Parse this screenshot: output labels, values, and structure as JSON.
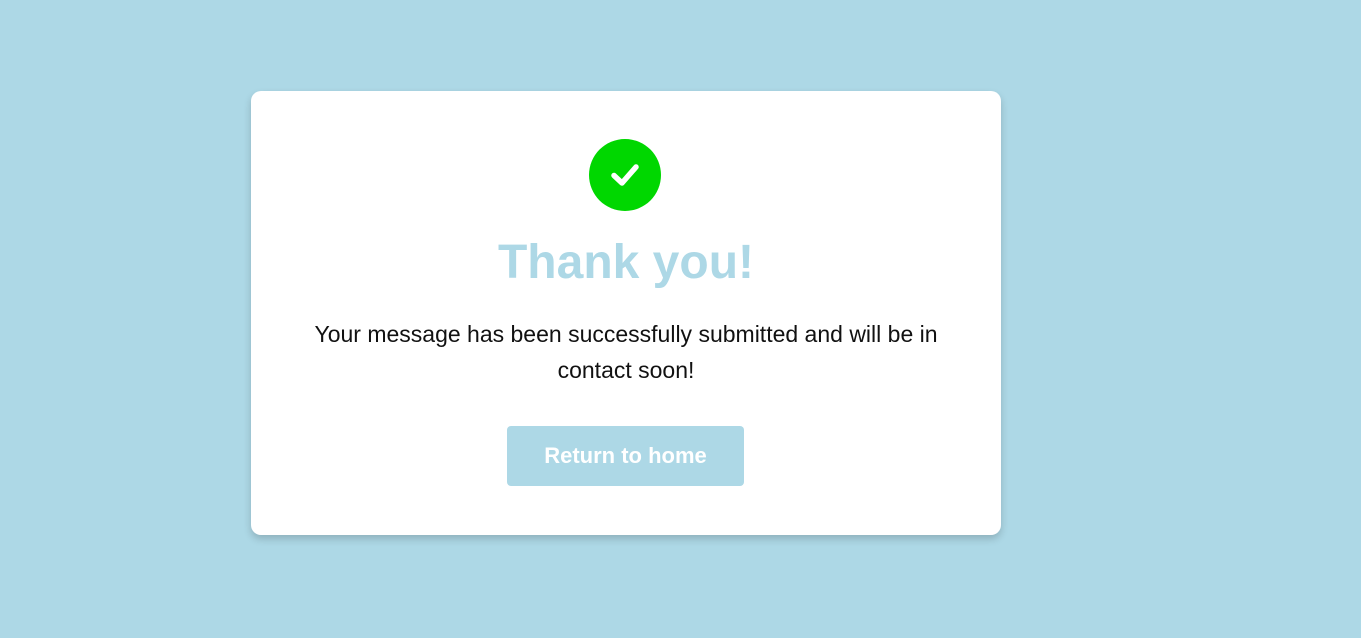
{
  "colors": {
    "background": "#add8e6",
    "card": "#ffffff",
    "success": "#00d700",
    "title": "#add8e6",
    "button": "#add8e6",
    "button_text": "#ffffff",
    "message_text": "#111111"
  },
  "card": {
    "icon": "check-circle-icon",
    "title": "Thank you!",
    "message": "Your message has been successfully submitted and will be in contact soon!",
    "button_label": "Return to home"
  }
}
